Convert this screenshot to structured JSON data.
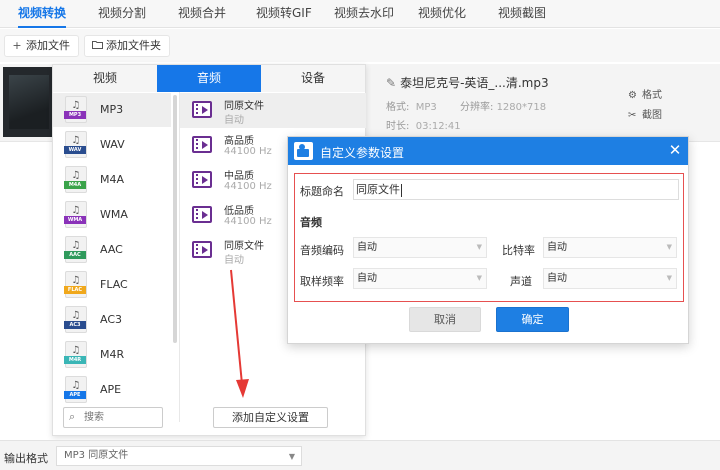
{
  "top_tabs": [
    {
      "label": "视频转换"
    },
    {
      "label": "视频分割"
    },
    {
      "label": "视频合并"
    },
    {
      "label": "视频转GIF"
    },
    {
      "label": "视频去水印"
    },
    {
      "label": "视频优化"
    },
    {
      "label": "视频截图"
    }
  ],
  "toolbar": {
    "add_file": "添加文件",
    "add_folder": "添加文件夹"
  },
  "file": {
    "name": "泰坦尼克号-英语_...清.mp3",
    "format_label": "格式:",
    "format_value": "MP3",
    "resolution_label": "分辨率:",
    "resolution_value": "1280*718",
    "duration_label": "时长:",
    "duration_value": "03:12:41",
    "format_action": "格式",
    "screenshot_action": "截图"
  },
  "panel": {
    "tabs": [
      {
        "label": "视频"
      },
      {
        "label": "音频"
      },
      {
        "label": "设备"
      }
    ],
    "formats": [
      {
        "label": "MP3",
        "color": "#8a32b9"
      },
      {
        "label": "WAV",
        "color": "#2a4d8f"
      },
      {
        "label": "M4A",
        "color": "#3aa34a"
      },
      {
        "label": "WMA",
        "color": "#8a32b9"
      },
      {
        "label": "AAC",
        "color": "#2f9a5c"
      },
      {
        "label": "FLAC",
        "color": "#f0a81c"
      },
      {
        "label": "AC3",
        "color": "#2a4d8f"
      },
      {
        "label": "M4R",
        "color": "#3ab6b6"
      },
      {
        "label": "APE",
        "color": "#1677e8"
      }
    ],
    "qualities": [
      {
        "name": "同原文件",
        "sub": "自动"
      },
      {
        "name": "高品质",
        "sub": "44100 Hz"
      },
      {
        "name": "中品质",
        "sub": "44100 Hz"
      },
      {
        "name": "低品质",
        "sub": "44100 Hz"
      },
      {
        "name": "同原文件",
        "sub": "自动"
      }
    ],
    "search_placeholder": "搜索",
    "add_custom": "添加自定义设置"
  },
  "dialog": {
    "title": "自定义参数设置",
    "name_label": "标题命名",
    "name_value": "同原文件",
    "audio_section": "音频",
    "codec_label": "音频编码",
    "codec_value": "自动",
    "bitrate_label": "比特率",
    "bitrate_value": "自动",
    "samplerate_label": "取样频率",
    "samplerate_value": "自动",
    "channels_label": "声道",
    "channels_value": "自动",
    "cancel": "取消",
    "ok": "确定"
  },
  "output": {
    "label": "输出格式",
    "value": "MP3  同原文件"
  },
  "colors": {
    "accent": "#1677e8",
    "highlight_border": "#e65050"
  }
}
